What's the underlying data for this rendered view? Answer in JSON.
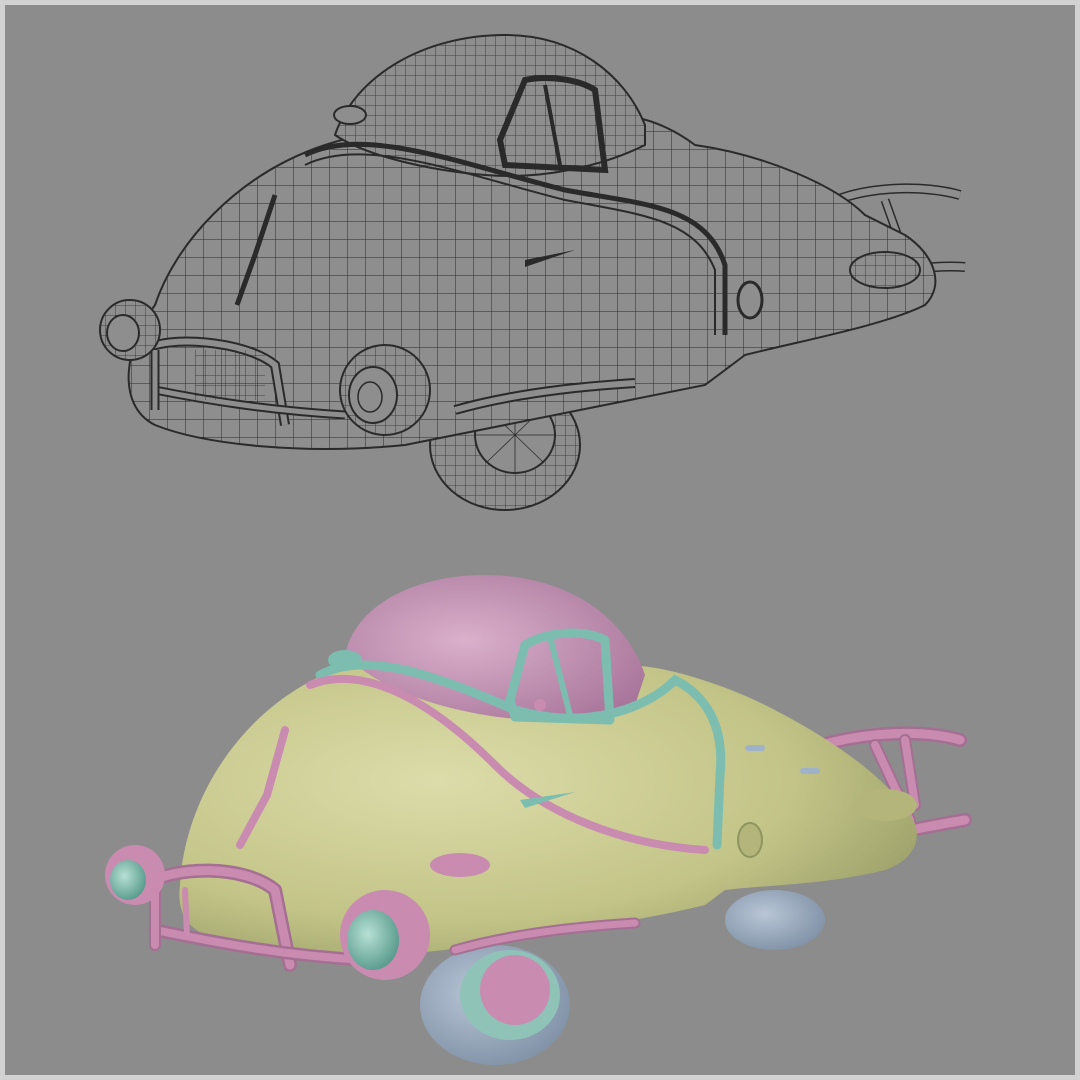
{
  "canvas": {
    "background": "#8c8c8c",
    "frame_border": "#d2d2d2"
  },
  "wireframe_render": {
    "label": "",
    "line_color": "#2a2a2a",
    "fill_color": "#8e8e8e"
  },
  "shaded_render": {
    "label": "",
    "palette": {
      "body": "#c8c98e",
      "body_shadow": "#8f9560",
      "dome": "#c28fb2",
      "dome_highlight": "#d6a8c6",
      "trim_teal": "#7cbdb0",
      "trim_pink": "#c98bb0",
      "tire_blue": "#9fb2c8",
      "hub_pink": "#c98bb0"
    }
  }
}
